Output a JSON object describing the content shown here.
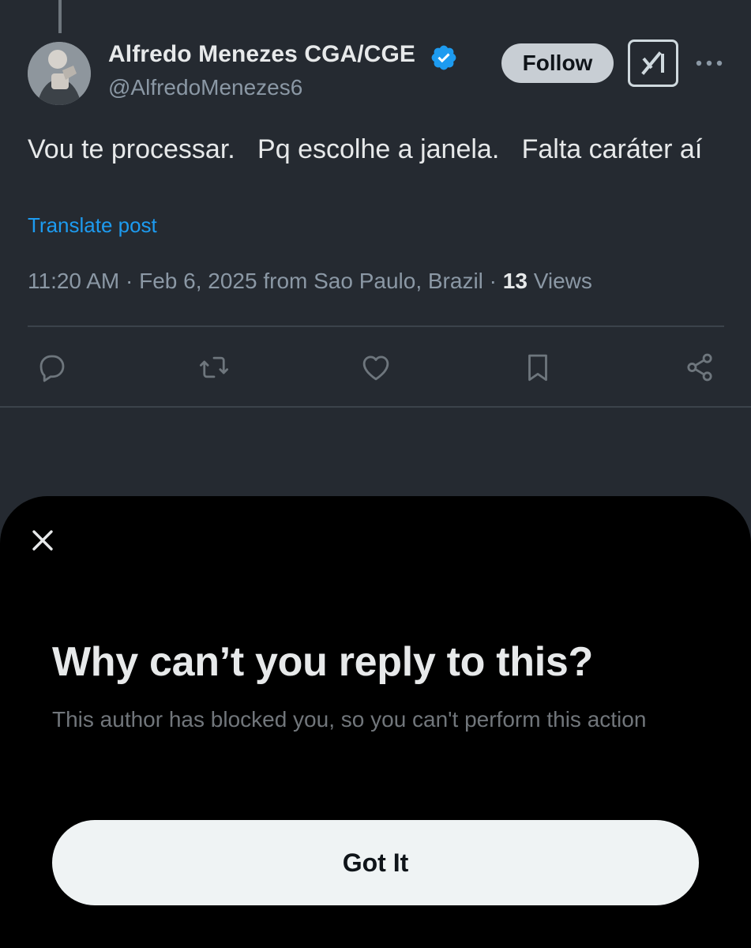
{
  "post": {
    "author": {
      "name": "Alfredo Menezes CGA/CGE",
      "handle": "@AlfredoMenezes6",
      "verified": true
    },
    "follow_label": "Follow",
    "text": "Vou te processar.   Pq escolhe a janela.   Falta caráter aí",
    "translate_label": "Translate post",
    "meta": {
      "time_date_location": "11:20 AM · Feb 6, 2025 from Sao Paulo, Brazil · ",
      "views_count": "13",
      "views_label": " Views"
    },
    "actions": [
      "reply-icon",
      "repost-icon",
      "like-icon",
      "bookmark-icon",
      "share-icon"
    ]
  },
  "sheet": {
    "title": "Why can’t you reply to this?",
    "description": "This author has blocked you, so you can't perform this action",
    "button_label": "Got It"
  },
  "colors": {
    "background": "#252a31",
    "sheet_background": "#000000",
    "accent": "#1d9bf0",
    "primary_text": "#e7e9ea",
    "secondary_text": "#8b98a5"
  }
}
